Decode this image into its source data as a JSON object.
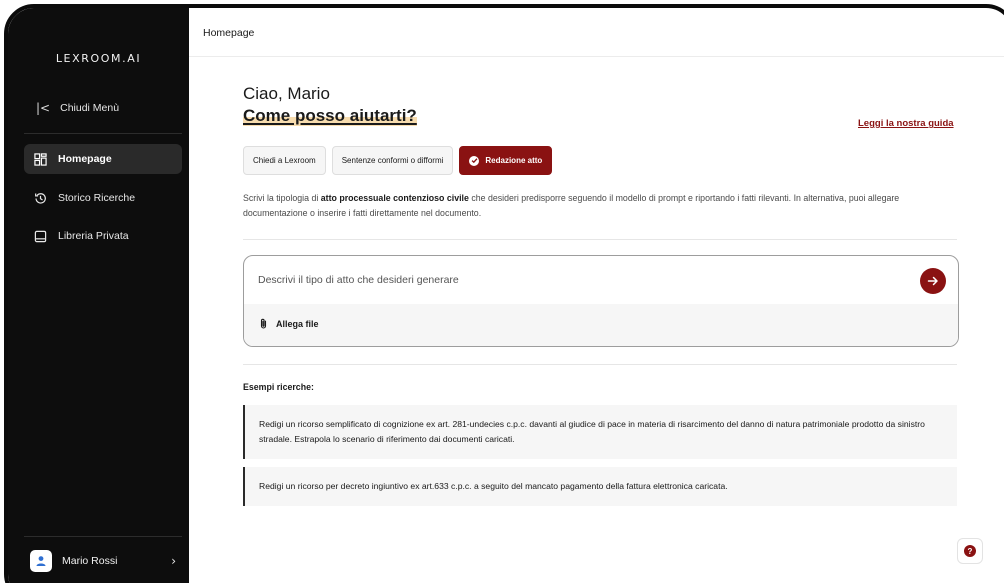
{
  "app": {
    "logo_text": "LEXROOM.AI"
  },
  "sidebar": {
    "close_menu_icon": "chevron-left-bar-icon",
    "close_menu_label": "Chiudi Menù",
    "items": [
      {
        "label": "Homepage",
        "icon": "grid-icon",
        "active": true
      },
      {
        "label": "Storico Ricerche",
        "icon": "history-icon",
        "active": false
      },
      {
        "label": "Libreria Privata",
        "icon": "book-icon",
        "active": false
      }
    ],
    "user": {
      "name": "Mario Rossi",
      "icon": "user-icon"
    }
  },
  "topbar": {
    "title": "Homepage"
  },
  "main": {
    "greeting": "Ciao, Mario",
    "headline": "Come posso aiutarti?",
    "guide_link": "Leggi la nostra guida",
    "tabs": [
      {
        "label": "Chiedi a Lexroom",
        "active": false
      },
      {
        "label": "Sentenze conformi o difformi",
        "active": false
      },
      {
        "label": "Redazione atto",
        "active": true
      }
    ],
    "description": {
      "part1": "Scrivi la tipologia di ",
      "bold": "atto processuale contenzioso civile",
      "part2": " che desideri predisporre seguendo il modello di prompt e riportando i fatti rilevanti. In alternativa, puoi allegare documentazione o inserire i fatti direttamente nel documento."
    },
    "composer": {
      "placeholder": "Descrivi il tipo di atto che desideri generare",
      "value": "",
      "attach_label": "Allega file",
      "send_icon": "arrow-right-icon",
      "attach_icon": "paperclip-icon"
    },
    "examples_title": "Esempi ricerche:",
    "examples": [
      "Redigi un ricorso semplificato di cognizione ex art. 281-undecies c.p.c. davanti al giudice di pace in materia di risarcimento del danno di natura patrimoniale prodotto da sinistro stradale. Estrapola lo scenario di riferimento dai documenti caricati.",
      "Redigi un ricorso per decreto ingiuntivo ex art.633 c.p.c. a seguito del mancato pagamento della fattura elettronica caricata."
    ],
    "help_button": "?"
  },
  "colors": {
    "accent": "#8a1212",
    "sidebar_bg": "#0d0d0d",
    "highlight": "#f7dcae"
  }
}
